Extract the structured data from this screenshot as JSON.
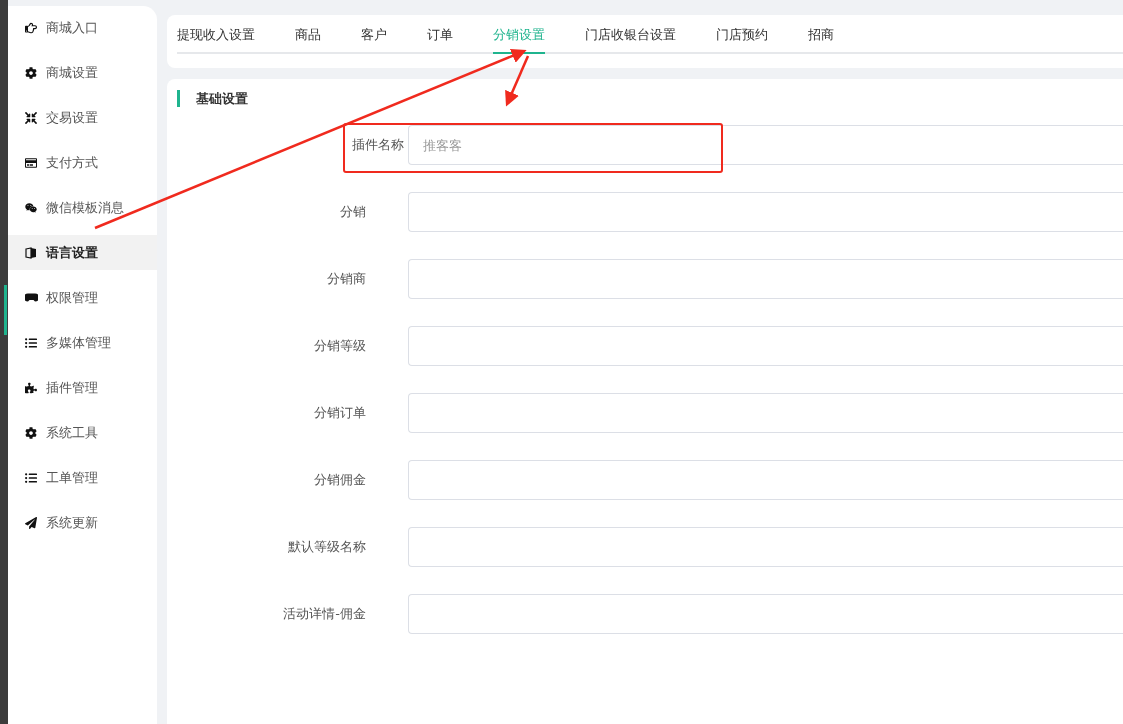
{
  "sidebar": {
    "items": [
      {
        "label": "商城入口",
        "selected": false
      },
      {
        "label": "商城设置",
        "selected": false
      },
      {
        "label": "交易设置",
        "selected": false
      },
      {
        "label": "支付方式",
        "selected": false
      },
      {
        "label": "微信模板消息",
        "selected": false
      },
      {
        "label": "语言设置",
        "selected": true
      },
      {
        "label": "权限管理",
        "selected": false
      },
      {
        "label": "多媒体管理",
        "selected": false
      },
      {
        "label": "插件管理",
        "selected": false
      },
      {
        "label": "系统工具",
        "selected": false
      },
      {
        "label": "工单管理",
        "selected": false
      },
      {
        "label": "系统更新",
        "selected": false
      }
    ]
  },
  "tabs": [
    {
      "label": "提现收入设置",
      "selected": false
    },
    {
      "label": "商品",
      "selected": false
    },
    {
      "label": "客户",
      "selected": false
    },
    {
      "label": "订单",
      "selected": false
    },
    {
      "label": "分销设置",
      "selected": true
    },
    {
      "label": "门店收银台设置",
      "selected": false
    },
    {
      "label": "门店预约",
      "selected": false
    },
    {
      "label": "招商",
      "selected": false
    }
  ],
  "section": {
    "title": "基础设置"
  },
  "fields": [
    {
      "label": "插件名称",
      "placeholder": "推客客",
      "highlighted": true
    },
    {
      "label": "分销",
      "highlighted": false
    },
    {
      "label": "分销商",
      "highlighted": false
    },
    {
      "label": "分销等级",
      "highlighted": false
    },
    {
      "label": "分销订单",
      "highlighted": false
    },
    {
      "label": "分销佣金",
      "highlighted": false
    },
    {
      "label": "默认等级名称",
      "highlighted": false
    },
    {
      "label": "活动详情-佣金",
      "highlighted": false
    }
  ]
}
